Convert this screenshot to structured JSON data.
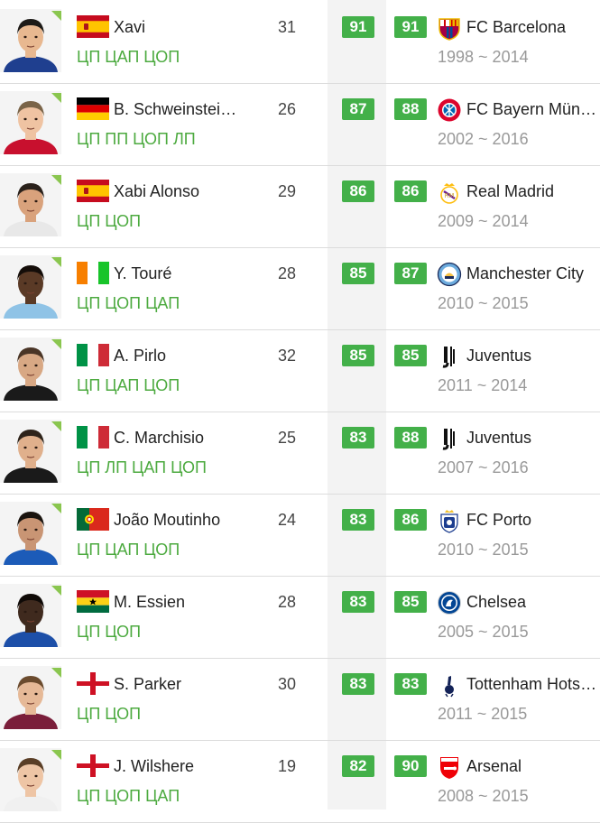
{
  "colors": {
    "accent_green": "#43b049",
    "position_green": "#4caa3f",
    "years_gray": "#999999",
    "separator": "#dcdcdc"
  },
  "players": [
    {
      "name": "Xavi",
      "flag": "spain",
      "positions": "ЦП ЦАП ЦОП",
      "age": "31",
      "overall": "91",
      "potential": "91",
      "club": "FC Barcelona",
      "club_icon": "barcelona-crest-icon",
      "years": "1998 ~ 2014",
      "skin": "#e8b890",
      "hair": "#1d1a17",
      "shirt": "#1f3f8f"
    },
    {
      "name": "B. Schweinsteiger",
      "flag": "germany",
      "positions": "ЦП ПП ЦОП ЛП",
      "age": "26",
      "overall": "87",
      "potential": "88",
      "club": "FC Bayern München",
      "club_icon": "bayern-crest-icon",
      "years": "2002 ~ 2016",
      "skin": "#efc3a2",
      "hair": "#7a6448",
      "shirt": "#c8102e"
    },
    {
      "name": "Xabi Alonso",
      "flag": "spain",
      "positions": "ЦП ЦОП",
      "age": "29",
      "overall": "86",
      "potential": "86",
      "club": "Real Madrid",
      "club_icon": "real-madrid-crest-icon",
      "years": "2009 ~ 2014",
      "skin": "#d9a27c",
      "hair": "#2a211b",
      "shirt": "#e8e8e8"
    },
    {
      "name": "Y. Touré",
      "flag": "ivory-coast",
      "positions": "ЦП ЦОП ЦАП",
      "age": "28",
      "overall": "85",
      "potential": "87",
      "club": "Manchester City",
      "club_icon": "manchester-city-crest-icon",
      "years": "2010 ~ 2015",
      "skin": "#5a3a26",
      "hair": "#140d09",
      "shirt": "#8fc3e6"
    },
    {
      "name": "A. Pirlo",
      "flag": "italy",
      "positions": "ЦП ЦАП ЦОП",
      "age": "32",
      "overall": "85",
      "potential": "85",
      "club": "Juventus",
      "club_icon": "juventus-crest-icon",
      "years": "2011 ~ 2014",
      "skin": "#d8a884",
      "hair": "#4a3526",
      "shirt": "#1a1a1a"
    },
    {
      "name": "C. Marchisio",
      "flag": "italy",
      "positions": "ЦП ЛП ЦАП ЦОП",
      "age": "25",
      "overall": "83",
      "potential": "88",
      "club": "Juventus",
      "club_icon": "juventus-crest-icon",
      "years": "2007 ~ 2016",
      "skin": "#e0b08c",
      "hair": "#2e231a",
      "shirt": "#1a1a1a"
    },
    {
      "name": "João Moutinho",
      "flag": "portugal",
      "positions": "ЦП ЦАП ЦОП",
      "age": "24",
      "overall": "83",
      "potential": "86",
      "club": "FC Porto",
      "club_icon": "porto-crest-icon",
      "years": "2010 ~ 2015",
      "skin": "#c99574",
      "hair": "#1a140f",
      "shirt": "#1c5bb8"
    },
    {
      "name": "M. Essien",
      "flag": "ghana",
      "positions": "ЦП ЦОП",
      "age": "28",
      "overall": "83",
      "potential": "85",
      "club": "Chelsea",
      "club_icon": "chelsea-crest-icon",
      "years": "2005 ~ 2015",
      "skin": "#3f2a1e",
      "hair": "#0f0a07",
      "shirt": "#1d4fa8"
    },
    {
      "name": "S. Parker",
      "flag": "england",
      "positions": "ЦП ЦОП",
      "age": "30",
      "overall": "83",
      "potential": "83",
      "club": "Tottenham Hotspur",
      "club_icon": "tottenham-crest-icon",
      "years": "2011 ~ 2015",
      "skin": "#e6b997",
      "hair": "#6b4b2e",
      "shirt": "#7a1e3a"
    },
    {
      "name": "J. Wilshere",
      "flag": "england",
      "positions": "ЦП ЦОП ЦАП",
      "age": "19",
      "overall": "82",
      "potential": "90",
      "club": "Arsenal",
      "club_icon": "arsenal-crest-icon",
      "years": "2008 ~ 2015",
      "skin": "#eec5a5",
      "hair": "#5a3e26",
      "shirt": "#f0f0f0"
    }
  ]
}
